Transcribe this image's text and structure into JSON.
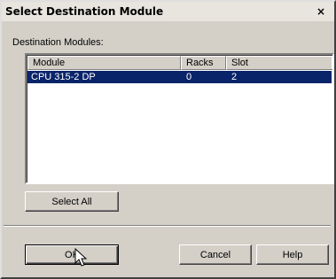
{
  "window": {
    "title": "Select Destination Module",
    "close_label": "×"
  },
  "main": {
    "list_label": "Destination Modules:",
    "columns": [
      "Module",
      "Racks",
      "Slot"
    ],
    "rows": [
      {
        "module": "CPU 315-2 DP",
        "racks": "0",
        "slot": "2",
        "selected": true
      }
    ]
  },
  "buttons": {
    "select_all": "Select All",
    "ok": "OK",
    "cancel": "Cancel",
    "help": "Help"
  },
  "colors": {
    "dialog_bg": "#d4d0c8",
    "selection_bg": "#0a246a",
    "selection_fg": "#ffffff"
  },
  "icons": {
    "cursor": "mouse-pointer-icon"
  }
}
